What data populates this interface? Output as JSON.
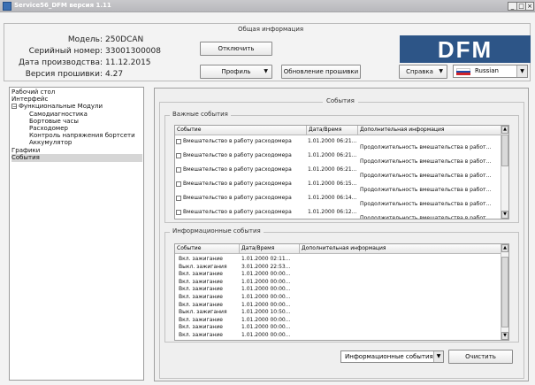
{
  "window": {
    "title": "Service56_DFM версия 1.11",
    "controls": [
      "_",
      "□",
      "×"
    ]
  },
  "general_info": {
    "legend": "Общая информация",
    "fields": [
      {
        "label": "Модель:",
        "value": "250DCAN"
      },
      {
        "label": "Серийный номер:",
        "value": "33001300008"
      },
      {
        "label": "Дата производства:",
        "value": "11.12.2015"
      },
      {
        "label": "Версия прошивки:",
        "value": "4.27"
      }
    ],
    "disconnect_label": "Отключить",
    "profile_label": "Профиль",
    "firmware_update_label": "Обновление прошивки",
    "help_label": "Справка",
    "language": "Russian",
    "logo_text": "DFM"
  },
  "tree": [
    {
      "label": "Рабочий стол",
      "level": 0,
      "box": ""
    },
    {
      "label": "Интерфейс",
      "level": 0,
      "box": ""
    },
    {
      "label": "Функциональные Модули",
      "level": 0,
      "box": "−"
    },
    {
      "label": "Самодиагностика",
      "level": 1,
      "box": ""
    },
    {
      "label": "Бортовые часы",
      "level": 1,
      "box": ""
    },
    {
      "label": "Расходомер",
      "level": 1,
      "box": ""
    },
    {
      "label": "Контроль напряжения бортсети",
      "level": 1,
      "box": ""
    },
    {
      "label": "Аккумулятор",
      "level": 1,
      "box": ""
    },
    {
      "label": "Графики",
      "level": 0,
      "box": ""
    },
    {
      "label": "События",
      "level": 0,
      "box": "",
      "selected": true
    }
  ],
  "events": {
    "legend": "События",
    "important": {
      "legend": "Важные события",
      "columns": [
        "Событие",
        "Дата/Время",
        "Дополнительная информация"
      ],
      "rows": [
        {
          "event": "Вмешательство в работу расходомера",
          "datetime": "1.01.2000 06:21...",
          "info": "Продолжительность вмешательства в работ..."
        },
        {
          "event": "Вмешательство в работу расходомера",
          "datetime": "1.01.2000 06:21...",
          "info": "Продолжительность вмешательства в работ..."
        },
        {
          "event": "Вмешательство в работу расходомера",
          "datetime": "1.01.2000 06:21...",
          "info": "Продолжительность вмешательства в работ..."
        },
        {
          "event": "Вмешательство в работу расходомера",
          "datetime": "1.01.2000 06:15...",
          "info": "Продолжительность вмешательства в работ..."
        },
        {
          "event": "Вмешательство в работу расходомера",
          "datetime": "1.01.2000 06:14...",
          "info": "Продолжительность вмешательства в работ..."
        },
        {
          "event": "Вмешательство в работу расходомера",
          "datetime": "1.01.2000 06:12...",
          "info": "Продолжительность вмешательства в работ..."
        }
      ]
    },
    "informational": {
      "legend": "Информационные события",
      "columns": [
        "Событие",
        "Дата/Время",
        "Дополнительная информация"
      ],
      "rows": [
        {
          "event": "Вкл. зажигание",
          "datetime": "1.01.2000 02:11..."
        },
        {
          "event": "Выкл. зажигания",
          "datetime": "3.01.2000 22:53..."
        },
        {
          "event": "Вкл. зажигание",
          "datetime": "1.01.2000 00:00..."
        },
        {
          "event": "Вкл. зажигание",
          "datetime": "1.01.2000 00:00..."
        },
        {
          "event": "Вкл. зажигание",
          "datetime": "1.01.2000 00:00..."
        },
        {
          "event": "Вкл. зажигание",
          "datetime": "1.01.2000 00:00..."
        },
        {
          "event": "Вкл. зажигание",
          "datetime": "1.01.2000 00:00..."
        },
        {
          "event": "Выкл. зажигания",
          "datetime": "1.01.2000 10:50..."
        },
        {
          "event": "Вкл. зажигание",
          "datetime": "1.01.2000 00:00..."
        },
        {
          "event": "Вкл. зажигание",
          "datetime": "1.01.2000 00:00..."
        },
        {
          "event": "Вкл. зажигание",
          "datetime": "1.01.2000 00:00..."
        }
      ]
    },
    "filter_value": "Информационные события",
    "clear_label": "Очистить"
  },
  "colors": {
    "logo_bg": "#2d5587",
    "selection": "#d6d6d6"
  }
}
